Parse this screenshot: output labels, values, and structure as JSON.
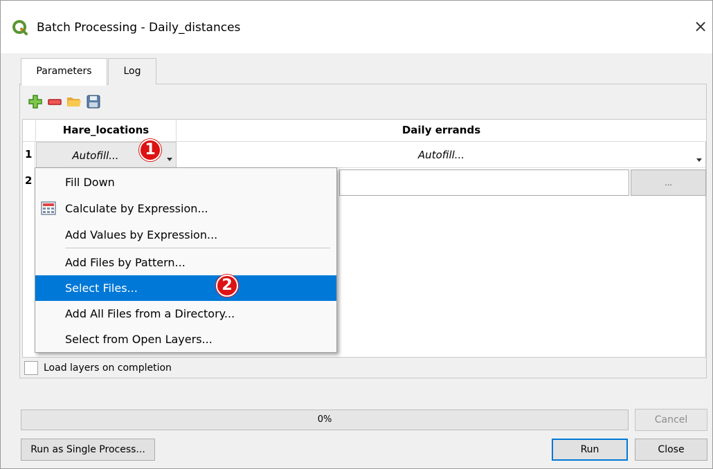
{
  "window": {
    "title": "Batch Processing - Daily_distances",
    "icons": {
      "app": "qgis-logo-icon",
      "close": "close-icon"
    },
    "close_glyph": "×"
  },
  "tabs": [
    {
      "label": "Parameters",
      "active": true
    },
    {
      "label": "Log",
      "active": false
    }
  ],
  "toolbar": {
    "icons": [
      "add-row-icon",
      "remove-row-icon",
      "open-folder-icon",
      "save-icon"
    ]
  },
  "table": {
    "columns": [
      "Hare_locations",
      "Daily errands"
    ],
    "rows": [
      {
        "number": "1",
        "cells": [
          "Autofill...",
          "Autofill..."
        ]
      },
      {
        "number": "2",
        "cells": [
          "",
          ""
        ],
        "browse_label": "..."
      }
    ]
  },
  "autofill_menu": {
    "items": [
      {
        "label": "Fill Down",
        "icon": ""
      },
      {
        "label": "Calculate by Expression...",
        "icon": "calculator-icon"
      },
      {
        "label": "Add Values by Expression...",
        "icon": ""
      },
      {
        "label": "Add Files by Pattern...",
        "icon": ""
      },
      {
        "label": "Select Files...",
        "icon": "",
        "selected": true
      },
      {
        "label": "Add All Files from a Directory...",
        "icon": ""
      },
      {
        "label": "Select from Open Layers...",
        "icon": ""
      }
    ]
  },
  "annotations": [
    {
      "label": "1",
      "color": "#dd1212"
    },
    {
      "label": "2",
      "color": "#dd1212"
    }
  ],
  "options": {
    "load_layers_label": "Load layers on completion",
    "load_layers_checked": false
  },
  "progress": {
    "value": 0,
    "text": "0%"
  },
  "buttons": {
    "cancel": "Cancel",
    "run_single": "Run as Single Process...",
    "run": "Run",
    "close": "Close"
  },
  "colors": {
    "selection": "#0078d7",
    "badge": "#dd1212",
    "window_bg": "#f0f0f0"
  }
}
